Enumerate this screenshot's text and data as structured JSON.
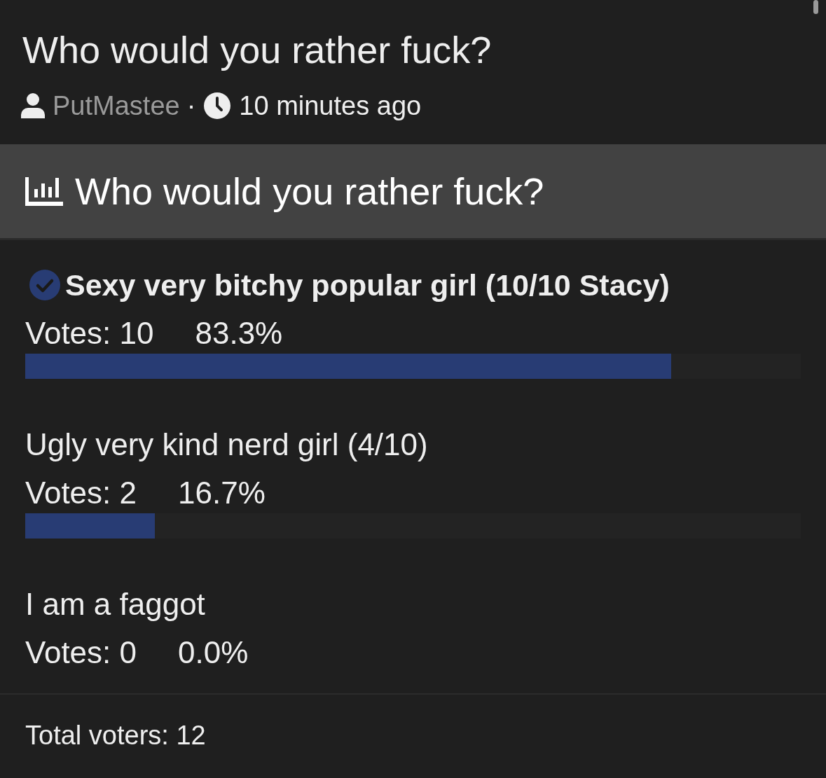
{
  "post": {
    "title": "Who would you rather fuck?",
    "author": "PutMastee",
    "separator": "·",
    "time": "10 minutes ago"
  },
  "poll": {
    "title": "Who would you rather fuck?",
    "options": [
      {
        "label": "Sexy very bitchy popular girl (10/10 Stacy)",
        "selected": true,
        "votes": "Votes: 10",
        "percent": "83.3%",
        "level": 0.833
      },
      {
        "label": "Ugly very kind nerd girl (4/10)",
        "selected": false,
        "votes": "Votes: 2",
        "percent": "16.7%",
        "level": 0.167
      },
      {
        "label": "I am a faggot",
        "selected": false,
        "votes": "Votes: 0",
        "percent": "0.0%"
      }
    ],
    "total": "Total voters: 12"
  }
}
